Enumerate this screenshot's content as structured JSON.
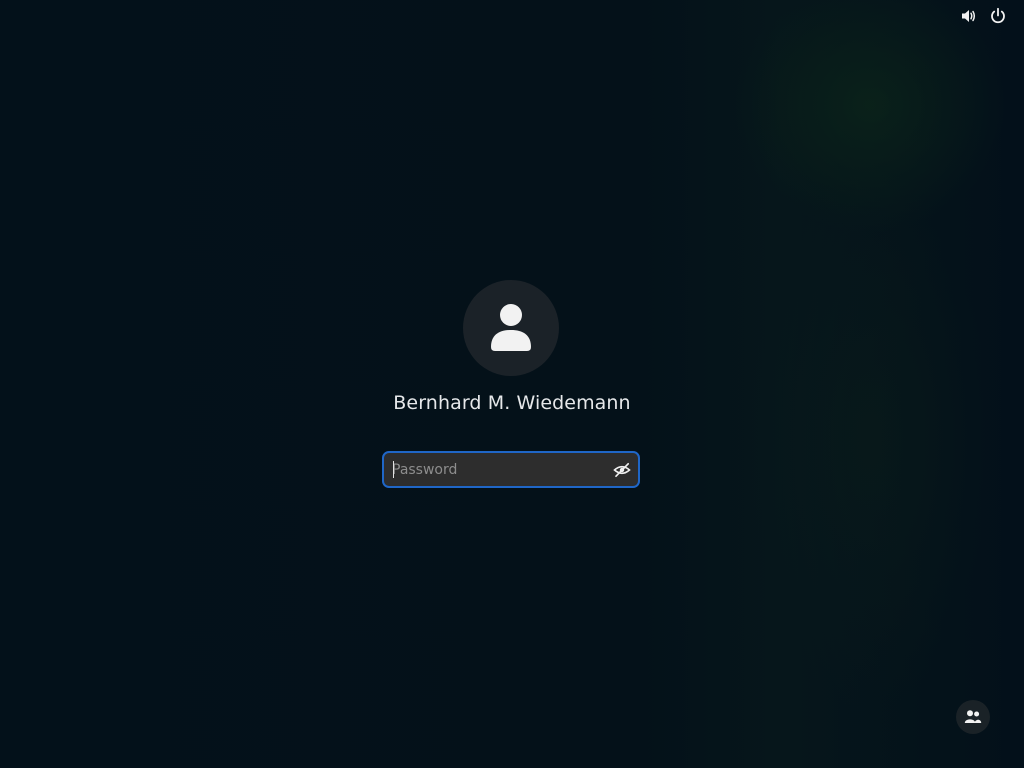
{
  "top_bar": {
    "volume_icon": "volume-icon",
    "power_icon": "power-icon"
  },
  "login": {
    "avatar_icon": "user-avatar-icon",
    "username": "Bernhard M. Wiedemann",
    "password": {
      "value": "",
      "placeholder": "Password",
      "reveal_icon": "eye-slash-icon"
    }
  },
  "footer": {
    "switch_user_icon": "users-icon"
  },
  "colors": {
    "background": "#03111a",
    "accent": "#1f66c7",
    "text": "#e6e8ea",
    "input_background": "#2d2d2d"
  }
}
